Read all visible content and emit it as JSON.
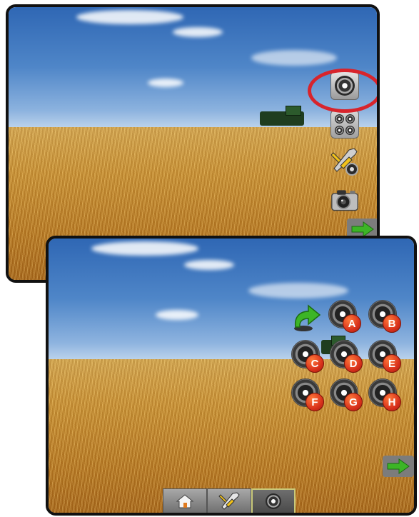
{
  "screens": {
    "main_view": {
      "side_buttons": [
        {
          "icon": "single-camera-icon"
        },
        {
          "icon": "four-camera-icon"
        },
        {
          "icon": "tools-camera-icon"
        },
        {
          "icon": "snapshot-camera-icon"
        }
      ],
      "next_icon": "right-arrow-icon",
      "highlight_color": "#d8242c"
    },
    "camera_select": {
      "back_icon": "green-return-arrow-icon",
      "camera_labels": [
        "A",
        "B",
        "C",
        "D",
        "E",
        "F",
        "G",
        "H"
      ],
      "badge_color": "#d9321c",
      "next_icon": "right-arrow-icon",
      "toolbar": [
        {
          "icon": "home-icon"
        },
        {
          "icon": "tools-icon"
        },
        {
          "icon": "camera-icon"
        }
      ]
    }
  },
  "colors": {
    "accent_green": "#3cb526",
    "frame": "#111111"
  }
}
